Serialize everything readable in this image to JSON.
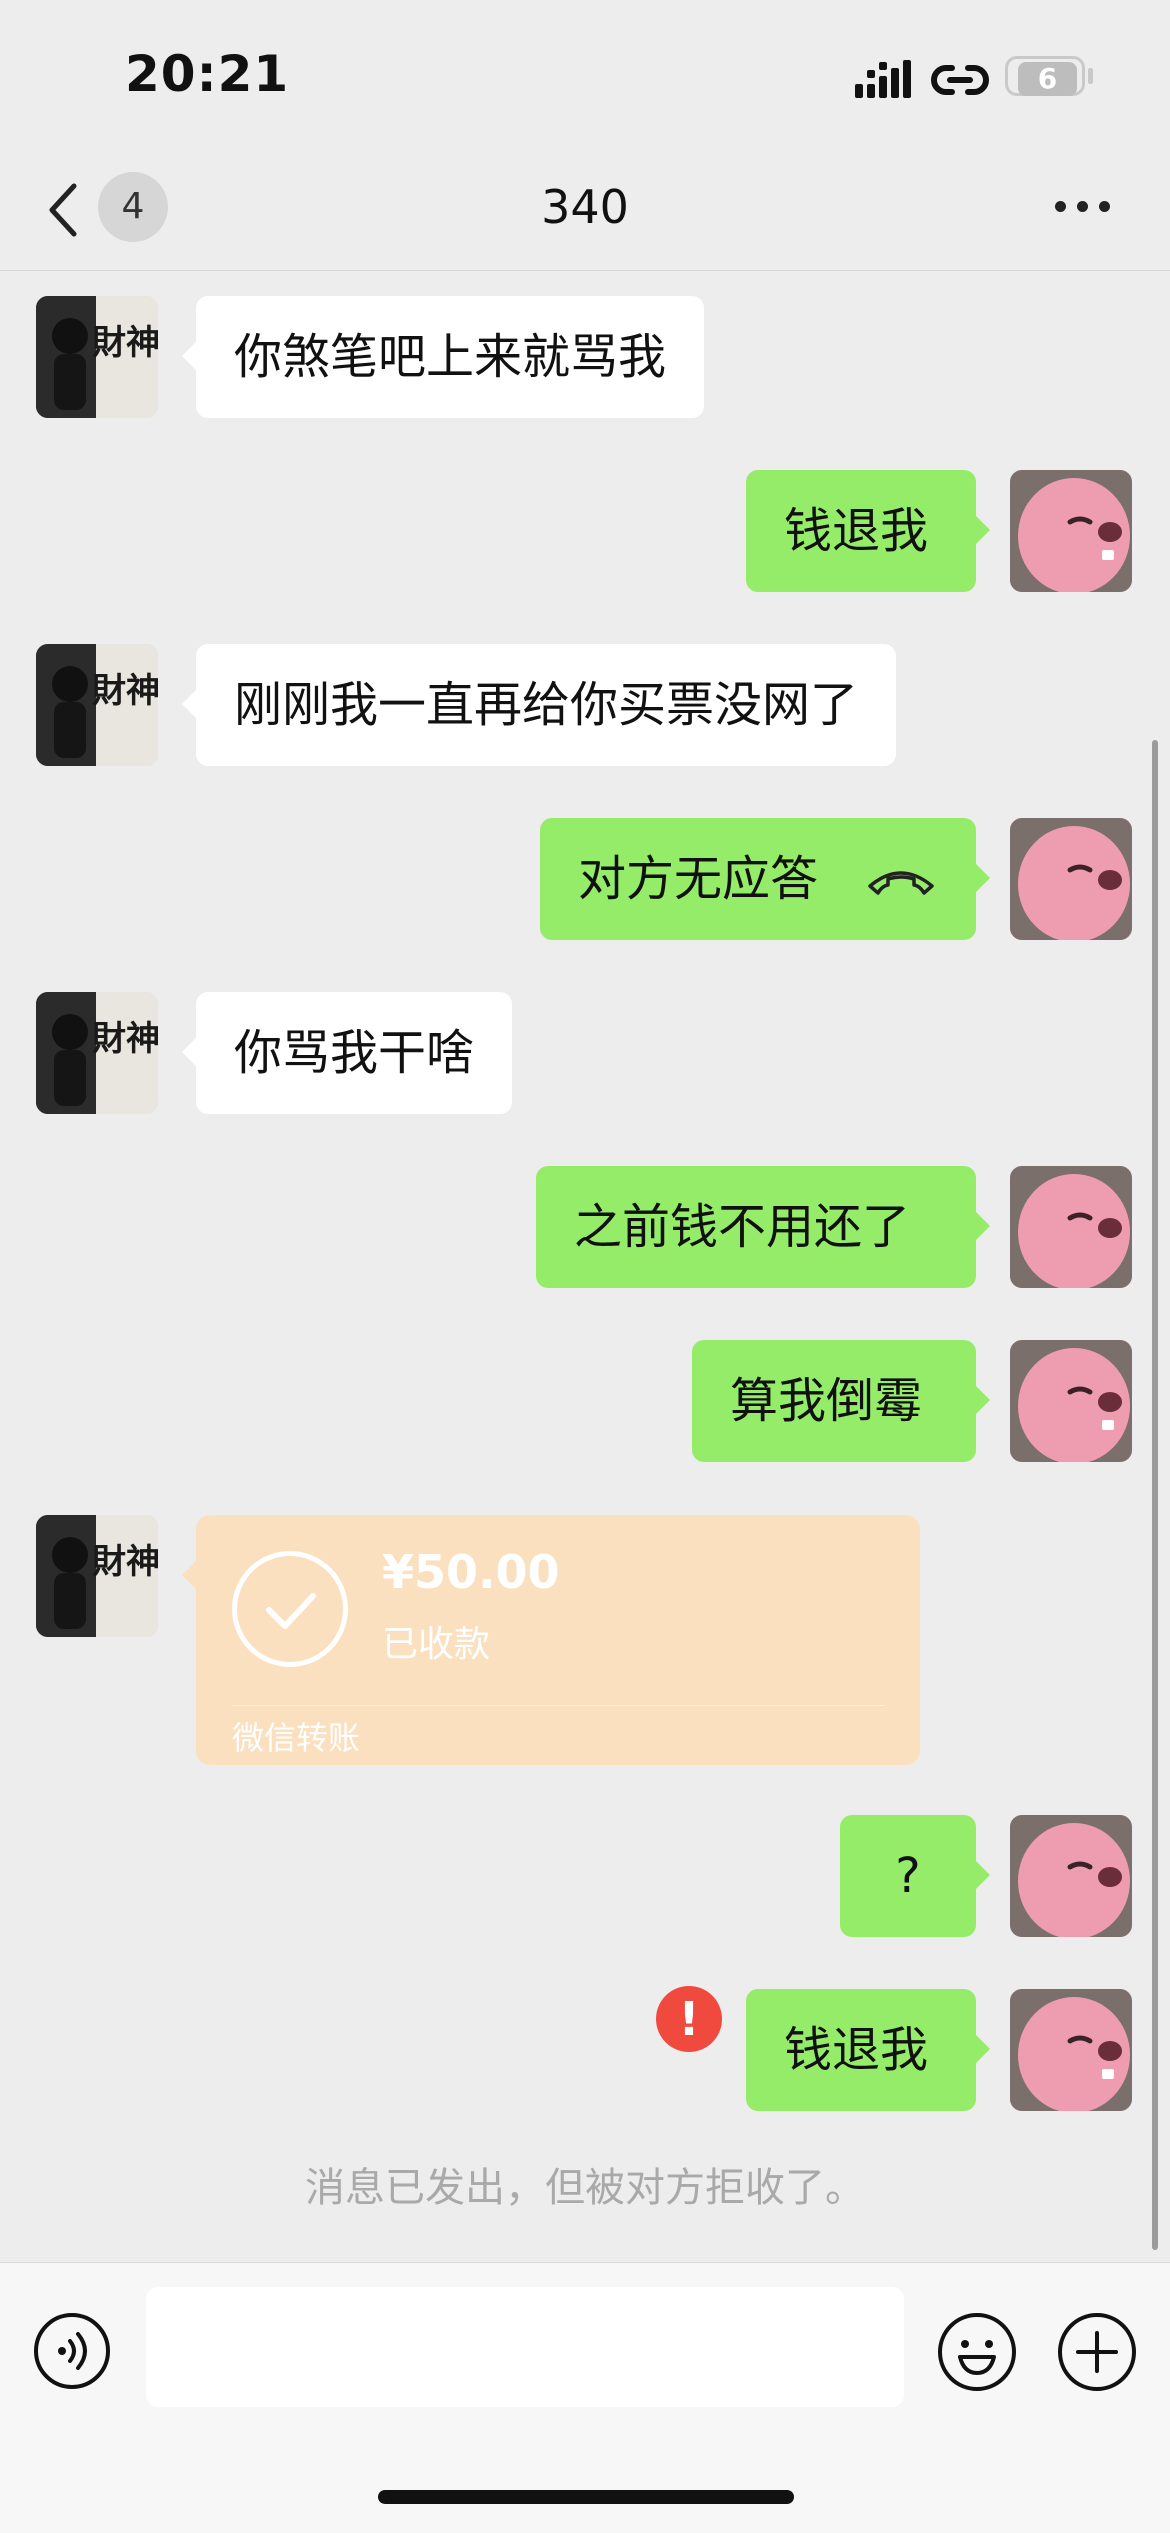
{
  "status": {
    "time": "20:21",
    "battery": "6"
  },
  "nav": {
    "unread": "4",
    "title": "340"
  },
  "messages": [
    {
      "side": "left",
      "text": "你煞笔吧上来就骂我"
    },
    {
      "side": "right",
      "text": "钱退我"
    },
    {
      "side": "left",
      "text": "刚刚我一直再给你买票没网了"
    },
    {
      "side": "right",
      "text": "对方无应答"
    },
    {
      "side": "left",
      "text": "你骂我干啥"
    },
    {
      "side": "right",
      "text": "之前钱不用还了"
    },
    {
      "side": "right",
      "text": "算我倒霉"
    },
    {
      "side": "right",
      "text": "?"
    },
    {
      "side": "right",
      "text": "钱退我"
    }
  ],
  "transfer": {
    "amount": "¥50.00",
    "status": "已收款",
    "label": "微信转账"
  },
  "error_mark": "!",
  "system_notice": "消息已发出，但被对方拒收了。",
  "avatar_left_text": "財神",
  "colors": {
    "bubble_out": "#95ec69",
    "bubble_in": "#ffffff",
    "transfer": "#fbe0c0",
    "error": "#f04a3f"
  }
}
